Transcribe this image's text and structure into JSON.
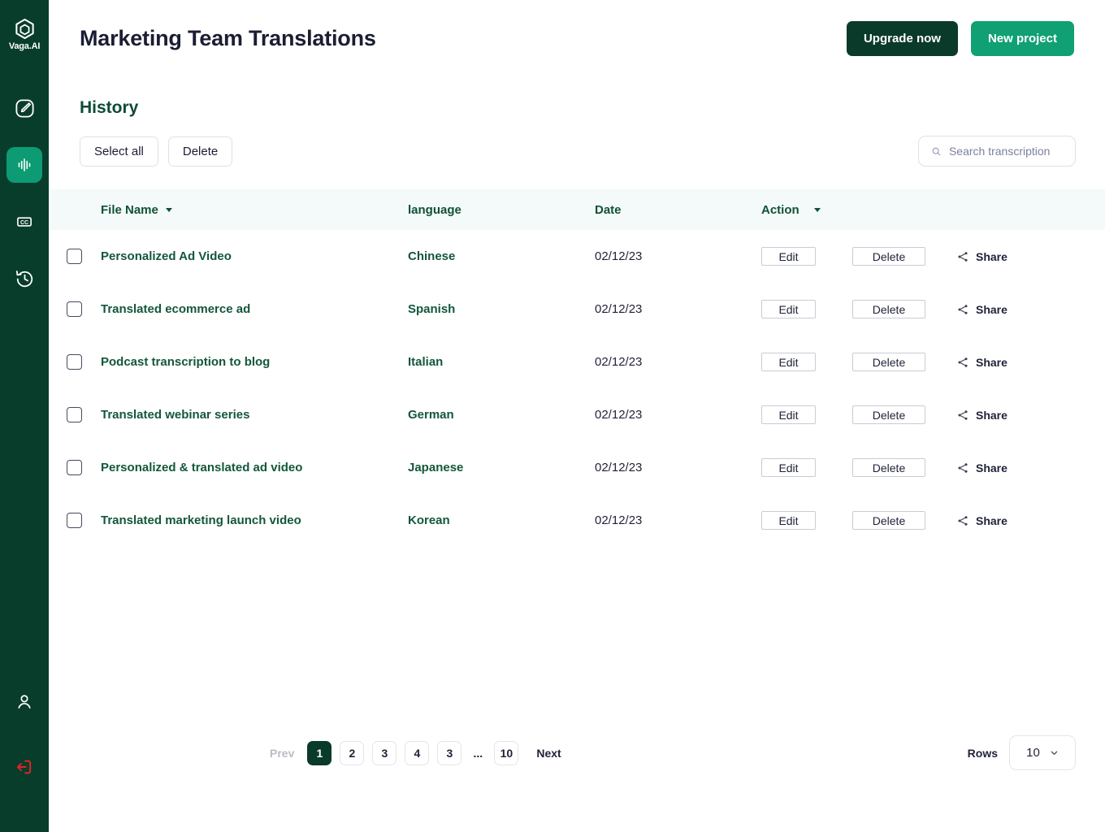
{
  "sidebar": {
    "logo": {
      "text": "Vaga.AI",
      "icon": "hexagon-logo-icon"
    },
    "items": [
      {
        "name": "edit-icon",
        "label": "Edit",
        "active": false
      },
      {
        "name": "waveform-icon",
        "label": "Transcribe",
        "active": true
      },
      {
        "name": "captions-icon",
        "label": "CC",
        "active": false
      },
      {
        "name": "history-icon",
        "label": "History",
        "active": false
      }
    ],
    "bottom_items": [
      {
        "name": "user-icon",
        "label": "Account"
      },
      {
        "name": "logout-icon",
        "label": "Log out"
      }
    ],
    "colors": {
      "background": "#083d2c",
      "active": "#0d9b74",
      "logout": "#e02424"
    }
  },
  "header": {
    "title": "Marketing Team Translations",
    "upgrade_label": "Upgrade now",
    "new_project_label": "New project",
    "upgrade_color": "#0a3a2a",
    "new_project_color": "#10a073"
  },
  "section": {
    "title": "History",
    "select_all_label": "Select all",
    "delete_label": "Delete"
  },
  "search": {
    "placeholder": "Search transcription",
    "value": "",
    "icon": "search-icon"
  },
  "table": {
    "columns": [
      {
        "label": "File Name",
        "sortable": true
      },
      {
        "label": "language",
        "sortable": false
      },
      {
        "label": "Date",
        "sortable": false
      },
      {
        "label": "Action",
        "sortable": true
      }
    ],
    "actions": {
      "edit": "Edit",
      "delete": "Delete",
      "share": "Share"
    },
    "rows": [
      {
        "name": "Personalized Ad Video",
        "language": "Chinese",
        "date": "02/12/23",
        "checked": false
      },
      {
        "name": "Translated ecommerce ad",
        "language": "Spanish",
        "date": "02/12/23",
        "checked": false
      },
      {
        "name": "Podcast transcription to blog",
        "language": "Italian",
        "date": "02/12/23",
        "checked": false
      },
      {
        "name": "Translated webinar series",
        "language": "German",
        "date": "02/12/23",
        "checked": false
      },
      {
        "name": "Personalized & translated ad video",
        "language": "Japanese",
        "date": "02/12/23",
        "checked": false
      },
      {
        "name": "Translated marketing launch video",
        "language": "Korean",
        "date": "02/12/23",
        "checked": false
      }
    ]
  },
  "pagination": {
    "prev_label": "Prev",
    "next_label": "Next",
    "pages": [
      "1",
      "2",
      "3",
      "4",
      "3"
    ],
    "ellipsis": "...",
    "last_page": "10",
    "current_page": "1",
    "rows_label": "Rows",
    "rows_value": "10"
  }
}
